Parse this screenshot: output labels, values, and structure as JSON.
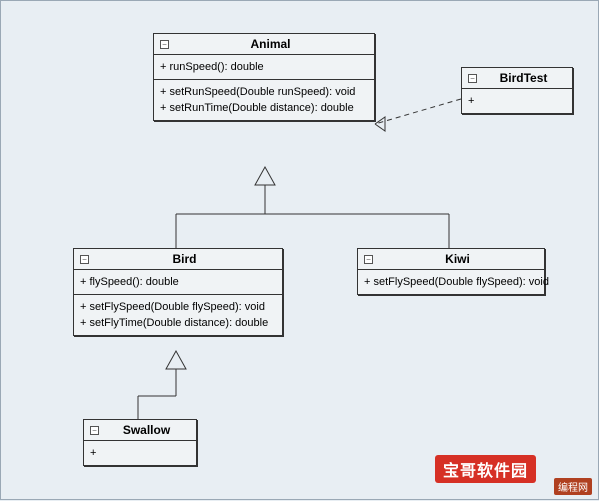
{
  "classes": {
    "animal": {
      "name": "Animal",
      "section1": [
        "+ runSpeed(): double"
      ],
      "section2": [
        "+ setRunSpeed(Double runSpeed): void",
        "+ setRunTime(Double distance): double"
      ]
    },
    "birdtest": {
      "name": "BirdTest",
      "section1": [
        "+"
      ]
    },
    "bird": {
      "name": "Bird",
      "section1": [
        "+ flySpeed(): double"
      ],
      "section2": [
        "+ setFlySpeed(Double flySpeed): void",
        "+ setFlyTime(Double distance): double"
      ]
    },
    "kiwi": {
      "name": "Kiwi",
      "section1": [
        "+ setFlySpeed(Double flySpeed): void"
      ]
    },
    "swallow": {
      "name": "Swallow",
      "section1": [
        "+"
      ]
    }
  },
  "badges": {
    "b1": "宝哥软件园",
    "b2": "编程网"
  }
}
